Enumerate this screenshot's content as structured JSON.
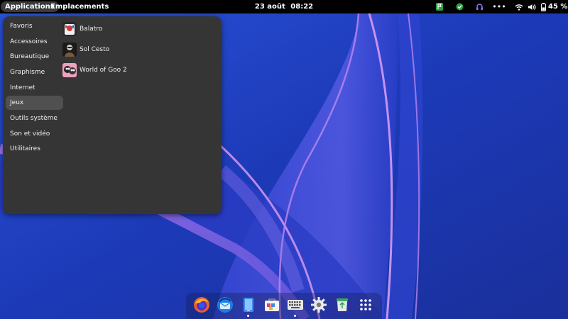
{
  "topbar": {
    "applications_label": "Applications",
    "places_label": "Emplacements",
    "date": "23 août",
    "time": "08:22",
    "battery_percent": "45 %",
    "tray_icons": [
      "flag-icon",
      "shield-check-icon",
      "headset-icon",
      "more-dots-icon",
      "wifi-icon",
      "volume-icon",
      "battery-icon"
    ]
  },
  "menu": {
    "categories": [
      {
        "label": "Favoris"
      },
      {
        "label": "Accessoires"
      },
      {
        "label": "Bureautique"
      },
      {
        "label": "Graphisme"
      },
      {
        "label": "Internet"
      },
      {
        "label": "Jeux",
        "active": true
      },
      {
        "label": "Outils système"
      },
      {
        "label": "Son et vidéo"
      },
      {
        "label": "Utilitaires"
      }
    ],
    "apps": [
      {
        "label": "Balatro",
        "icon": "balatro-icon"
      },
      {
        "label": "Sol Cesto",
        "icon": "sol-cesto-icon"
      },
      {
        "label": "World of Goo 2",
        "icon": "world-of-goo-2-icon"
      }
    ]
  },
  "dock": {
    "items": [
      {
        "icon": "firefox-icon",
        "running": false
      },
      {
        "icon": "thunderbird-icon",
        "running": false
      },
      {
        "icon": "tablet-app-icon",
        "running": true
      },
      {
        "icon": "software-store-icon",
        "running": false
      },
      {
        "icon": "keyboard-app-icon",
        "running": true
      },
      {
        "icon": "settings-gear-icon",
        "running": false
      },
      {
        "icon": "trash-recycle-icon",
        "running": false
      },
      {
        "icon": "app-grid-icon",
        "running": false
      }
    ]
  },
  "colors": {
    "topbar_bg": "#000000",
    "menu_bg": "#353535",
    "active_category_bg": "#505050",
    "wallpaper_blue": "#1e3bb0",
    "wallpaper_pink": "#c58ae8"
  }
}
